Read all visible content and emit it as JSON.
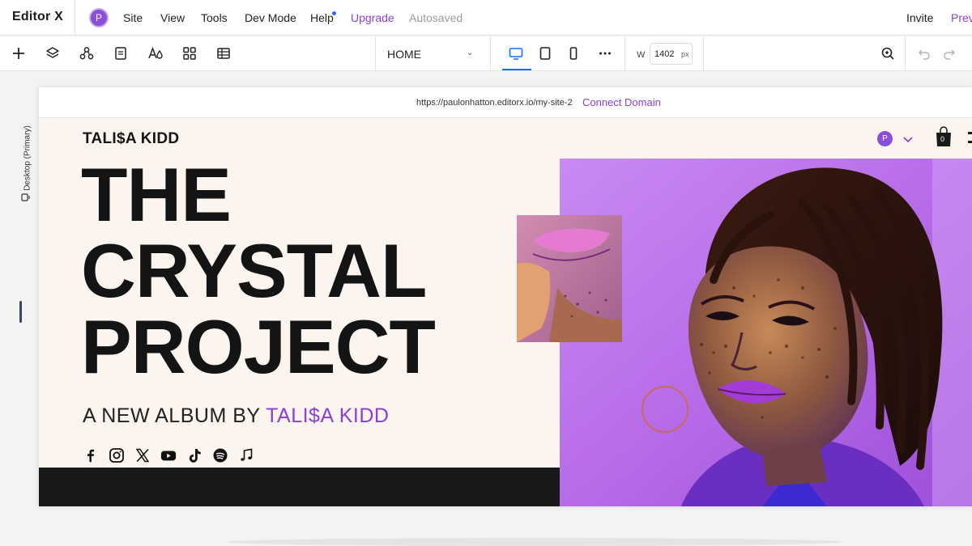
{
  "app": {
    "logo": "Editor X",
    "avatar_initial": "P",
    "menu": [
      "Site",
      "View",
      "Tools",
      "Dev Mode",
      "Help"
    ],
    "upgrade": "Upgrade",
    "status": "Autosaved",
    "invite": "Invite",
    "preview": "Previ"
  },
  "toolbar": {
    "page": "HOME",
    "width_label": "W",
    "width_value": "1402",
    "width_unit": "px",
    "active_device": "desktop"
  },
  "rail": {
    "breakpoint_label": "Desktop (Primary)"
  },
  "canvas": {
    "url": "https://paulonhatton.editorx.io/my-site-2",
    "connect_domain": "Connect Domain"
  },
  "site": {
    "brand": "TALI$A KIDD",
    "headline": [
      "THE",
      "CRYSTAL",
      "PROJECT"
    ],
    "subline_prefix": "A NEW ALBUM BY ",
    "subline_accent": "TALI$A KIDD",
    "avatar_initial": "P",
    "cart_count": "0",
    "socials": [
      "facebook-icon",
      "instagram-icon",
      "x-icon",
      "youtube-icon",
      "tiktok-icon",
      "spotify-icon",
      "music-note-icon"
    ]
  },
  "colors": {
    "accent": "#8b3fd6",
    "active_blue": "#116dff",
    "site_bg": "#fcf4ef",
    "dark_band": "#191919"
  }
}
